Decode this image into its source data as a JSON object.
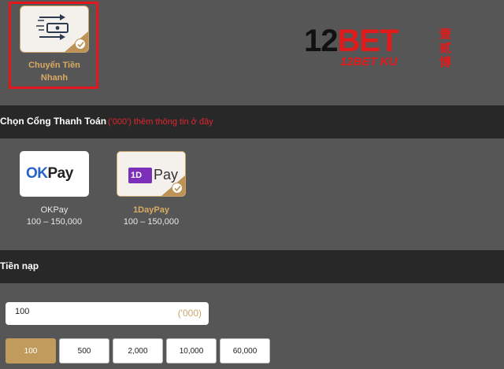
{
  "payment_method": {
    "label": "Chuyển Tiền Nhanh",
    "icon": "money-transfer-icon",
    "selected": true
  },
  "logo": {
    "main_number": "12",
    "main_text": "BET",
    "sub_text": "12BET KU",
    "chinese": "壹贰博"
  },
  "gateway_section": {
    "title": "Chọn Cổng Thanh Toán",
    "note": "('000') thêm thông tin ở đây"
  },
  "gateways": [
    {
      "name": "OKPay",
      "logo_ok": "OK",
      "logo_pay": "Pay",
      "range": "100 – 150,000",
      "selected": false
    },
    {
      "name": "1DayPay",
      "logo_mark": "1D",
      "logo_pay": "Pay",
      "range": "100 – 150,000",
      "selected": true
    }
  ],
  "amount_section": {
    "title": "Tiền nạp",
    "value": "100",
    "unit": "('000)"
  },
  "amount_chips": [
    {
      "label": "100",
      "active": true
    },
    {
      "label": "500",
      "active": false
    },
    {
      "label": "2,000",
      "active": false
    },
    {
      "label": "10,000",
      "active": false
    },
    {
      "label": "60,000",
      "active": false
    }
  ],
  "colors": {
    "accent_gold": "#c09b5c",
    "highlight_red": "#e4161b",
    "bar_dark": "#282828",
    "panel_gray": "#565656"
  }
}
